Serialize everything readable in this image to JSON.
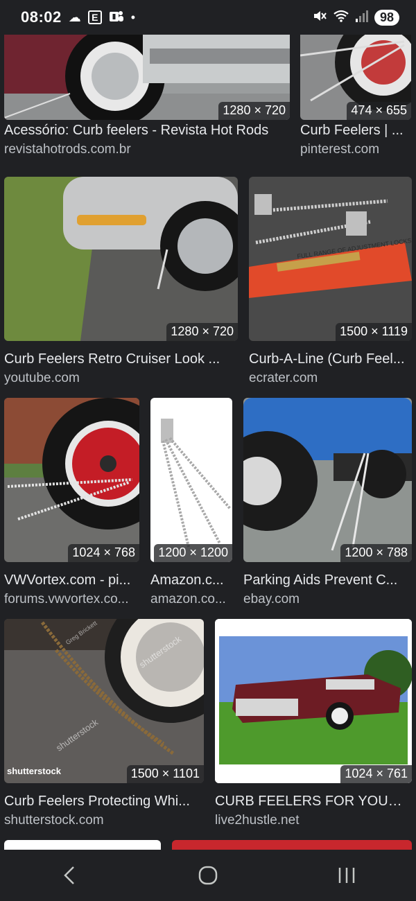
{
  "status_bar": {
    "time": "08:02",
    "letter_icon": "E",
    "battery": "98"
  },
  "results": [
    {
      "title": "Acessório: Curb feelers - Revista Hot Rods",
      "source": "revistahotrods.com.br",
      "dimensions": "1280 × 720"
    },
    {
      "title": "Curb Feelers | ...",
      "source": "pinterest.com",
      "dimensions": "474 × 655"
    },
    {
      "title": "Curb Feelers Retro Cruiser Look ...",
      "source": "youtube.com",
      "dimensions": "1280 × 720"
    },
    {
      "title": "Curb-A-Line (Curb Feel...",
      "source": "ecrater.com",
      "dimensions": "1500 × 1119"
    },
    {
      "title": "VWVortex.com - pi...",
      "source": "forums.vwvortex.co...",
      "dimensions": "1024 × 768"
    },
    {
      "title": "Amazon.c...",
      "source": "amazon.co...",
      "dimensions": "1200 × 1200"
    },
    {
      "title": "Parking Aids Prevent C...",
      "source": "ebay.com",
      "dimensions": "1200 × 788"
    },
    {
      "title": "Curb Feelers Protecting Whi...",
      "source": "shutterstock.com",
      "dimensions": "1500 × 1101"
    },
    {
      "title": "CURB FEELERS FOR YOUR ...",
      "source": "live2hustle.net",
      "dimensions": "1024 × 761"
    }
  ],
  "image_text": {
    "box_label": "FULL RANGE OF ADJUSTMENT  LOCKS IN PLACE",
    "watermark": "shutterstock",
    "watermark_brand": "Greg Brickett"
  },
  "colors": {
    "background": "#202124",
    "text": "#e8eaed",
    "source_text": "#bdc1c6"
  }
}
